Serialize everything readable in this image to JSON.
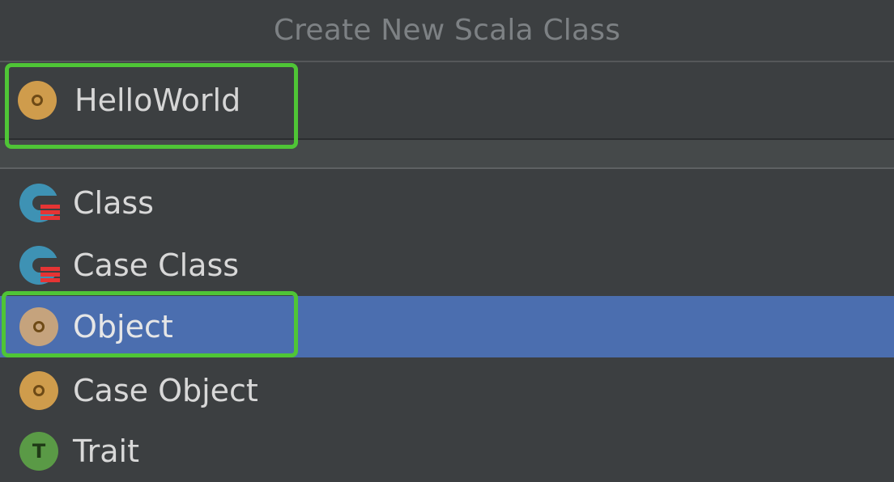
{
  "dialog": {
    "title": "Create New Scala Class",
    "name_field": {
      "value": "HelloWorld",
      "icon": "scala-object-icon"
    },
    "kinds": [
      {
        "label": "Class",
        "icon": "scala-class-icon",
        "selected": false
      },
      {
        "label": "Case Class",
        "icon": "scala-case-class-icon",
        "selected": false
      },
      {
        "label": "Object",
        "icon": "scala-object-icon",
        "selected": true
      },
      {
        "label": "Case Object",
        "icon": "scala-case-object-icon",
        "selected": false
      },
      {
        "label": "Trait",
        "icon": "scala-trait-icon",
        "selected": false,
        "icon_letter": "T"
      }
    ]
  },
  "colors": {
    "background": "#3c3f41",
    "selection": "#4b6eaf",
    "highlight_box": "#4fc536",
    "object_icon": "#cf9c4c",
    "class_icon": "#3e92b4",
    "trait_icon": "#5a9a46"
  }
}
